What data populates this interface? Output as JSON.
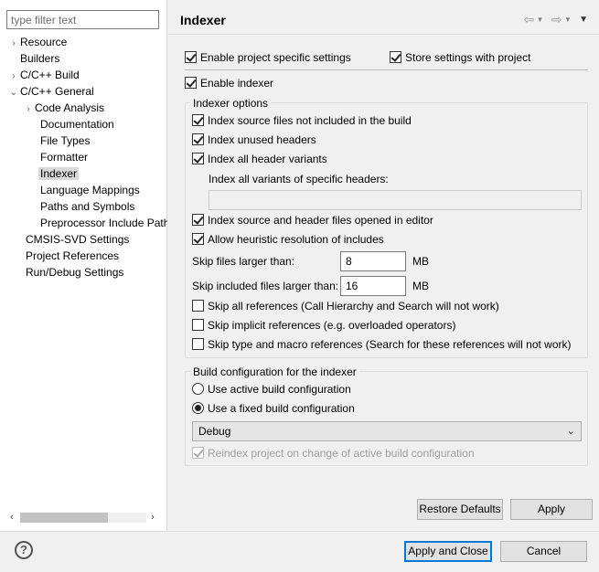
{
  "filter": {
    "placeholder": "type filter text",
    "value": ""
  },
  "tree": {
    "items": [
      {
        "label": "Resource",
        "twisty": "›"
      },
      {
        "label": "Builders",
        "twisty": ""
      },
      {
        "label": "C/C++ Build",
        "twisty": "›"
      },
      {
        "label": "C/C++ General",
        "twisty": "⌄"
      },
      {
        "label": "Code Analysis",
        "twisty": "›"
      },
      {
        "label": "Documentation",
        "twisty": ""
      },
      {
        "label": "File Types",
        "twisty": ""
      },
      {
        "label": "Formatter",
        "twisty": ""
      },
      {
        "label": "Indexer",
        "twisty": ""
      },
      {
        "label": "Language Mappings",
        "twisty": ""
      },
      {
        "label": "Paths and Symbols",
        "twisty": ""
      },
      {
        "label": "Preprocessor Include Paths",
        "twisty": ""
      },
      {
        "label": "CMSIS-SVD Settings",
        "twisty": ""
      },
      {
        "label": "Project References",
        "twisty": ""
      },
      {
        "label": "Run/Debug Settings",
        "twisty": ""
      }
    ],
    "selected": "Indexer"
  },
  "header": {
    "title": "Indexer"
  },
  "settings": {
    "enable_project_specific": "Enable project specific settings",
    "store_with_project": "Store settings with project",
    "enable_indexer": "Enable indexer"
  },
  "indexer_options": {
    "title": "Indexer options",
    "index_source_not_in_build": "Index source files not included in the build",
    "index_unused_headers": "Index unused headers",
    "index_all_header_variants": "Index all header variants",
    "variants_label": "Index all variants of specific headers:",
    "variants_value": "",
    "index_opened_in_editor": "Index source and header files opened in editor",
    "heuristic_resolution": "Allow heuristic resolution of includes",
    "skip_files_label": "Skip files larger than:",
    "skip_files_value": "8",
    "skip_files_unit": "MB",
    "skip_included_label": "Skip included files larger than:",
    "skip_included_value": "16",
    "skip_included_unit": "MB",
    "skip_all_refs": "Skip all references (Call Hierarchy and Search will not work)",
    "skip_implicit_refs": "Skip implicit references (e.g. overloaded operators)",
    "skip_type_macro_refs": "Skip type and macro references (Search for these references will not work)"
  },
  "build_config": {
    "title": "Build configuration for the indexer",
    "use_active": "Use active build configuration",
    "use_fixed": "Use a fixed build configuration",
    "selected_config": "Debug",
    "reindex": "Reindex project on change of active build configuration"
  },
  "buttons": {
    "restore_defaults": "Restore Defaults",
    "apply": "Apply",
    "apply_and_close": "Apply and Close",
    "cancel": "Cancel"
  },
  "help": {
    "glyph": "?"
  },
  "nav": {
    "back": "⇦",
    "forward": "⇨",
    "caret": "▾",
    "menu": "▼"
  }
}
